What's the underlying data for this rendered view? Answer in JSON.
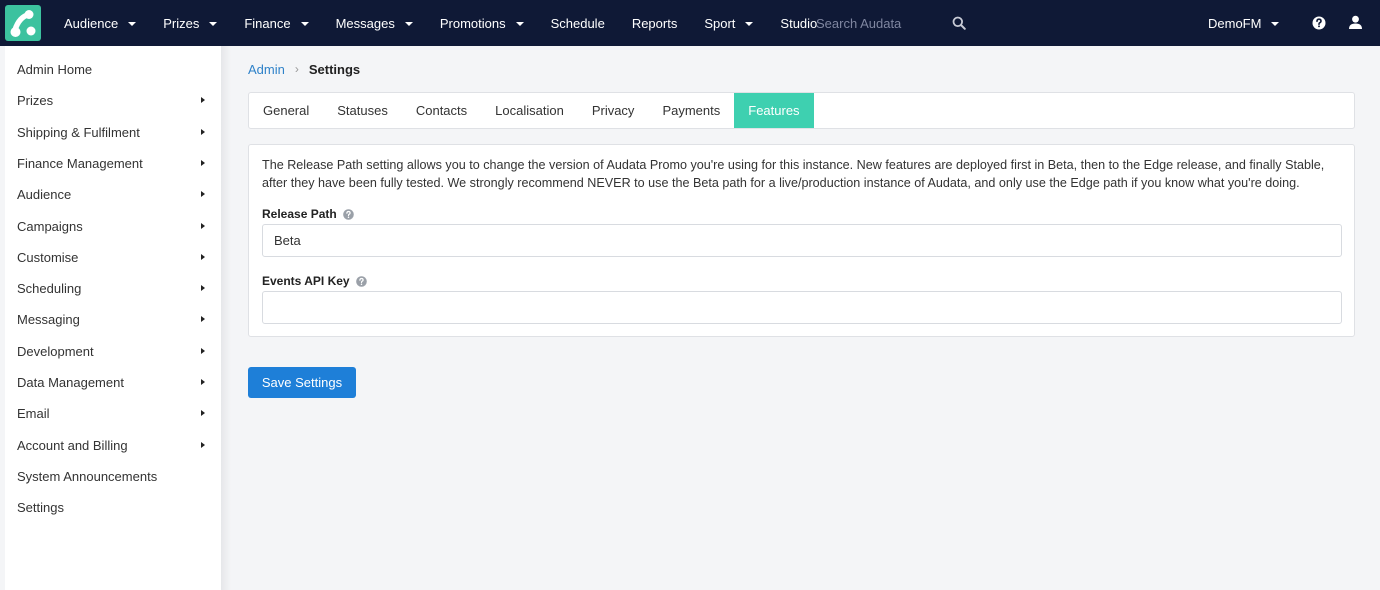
{
  "topnav": {
    "items": [
      {
        "label": "Audience",
        "dropdown": true
      },
      {
        "label": "Prizes",
        "dropdown": true
      },
      {
        "label": "Finance",
        "dropdown": true
      },
      {
        "label": "Messages",
        "dropdown": true
      },
      {
        "label": "Promotions",
        "dropdown": true
      },
      {
        "label": "Schedule",
        "dropdown": false
      },
      {
        "label": "Reports",
        "dropdown": false
      },
      {
        "label": "Sport",
        "dropdown": true
      },
      {
        "label": "Studio",
        "dropdown": false
      }
    ],
    "search_placeholder": "Search Audata",
    "account_label": "DemoFM",
    "colors": {
      "bar": "#0f1936",
      "logo": "#3cc29f"
    }
  },
  "sidebar": {
    "items": [
      {
        "label": "Admin Home",
        "has_submenu": false
      },
      {
        "label": "Prizes",
        "has_submenu": true
      },
      {
        "label": "Shipping & Fulfilment",
        "has_submenu": true
      },
      {
        "label": "Finance Management",
        "has_submenu": true
      },
      {
        "label": "Audience",
        "has_submenu": true
      },
      {
        "label": "Campaigns",
        "has_submenu": true
      },
      {
        "label": "Customise",
        "has_submenu": true
      },
      {
        "label": "Scheduling",
        "has_submenu": true
      },
      {
        "label": "Messaging",
        "has_submenu": true
      },
      {
        "label": "Development",
        "has_submenu": true
      },
      {
        "label": "Data Management",
        "has_submenu": true
      },
      {
        "label": "Email",
        "has_submenu": true
      },
      {
        "label": "Account and Billing",
        "has_submenu": true
      },
      {
        "label": "System Announcements",
        "has_submenu": false
      },
      {
        "label": "Settings",
        "has_submenu": false
      }
    ]
  },
  "breadcrumb": {
    "parent": "Admin",
    "separator": "›",
    "current": "Settings"
  },
  "tabs": {
    "items": [
      "General",
      "Statuses",
      "Contacts",
      "Localisation",
      "Privacy",
      "Payments",
      "Features"
    ],
    "active": "Features",
    "active_color": "#3ed0b0"
  },
  "panel": {
    "description": "The Release Path setting allows you to change the version of Audata Promo you're using for this instance. New features are deployed first in Beta, then to the Edge release, and finally Stable, after they have been fully tested. We strongly recommend NEVER to use the Beta path for a live/production instance of Audata, and only use the Edge path if you know what you're doing.",
    "release_path": {
      "label": "Release Path",
      "value": "Beta"
    },
    "events_api_key": {
      "label": "Events API Key",
      "value": ""
    }
  },
  "actions": {
    "save_label": "Save Settings",
    "save_color": "#1e7fd8"
  }
}
